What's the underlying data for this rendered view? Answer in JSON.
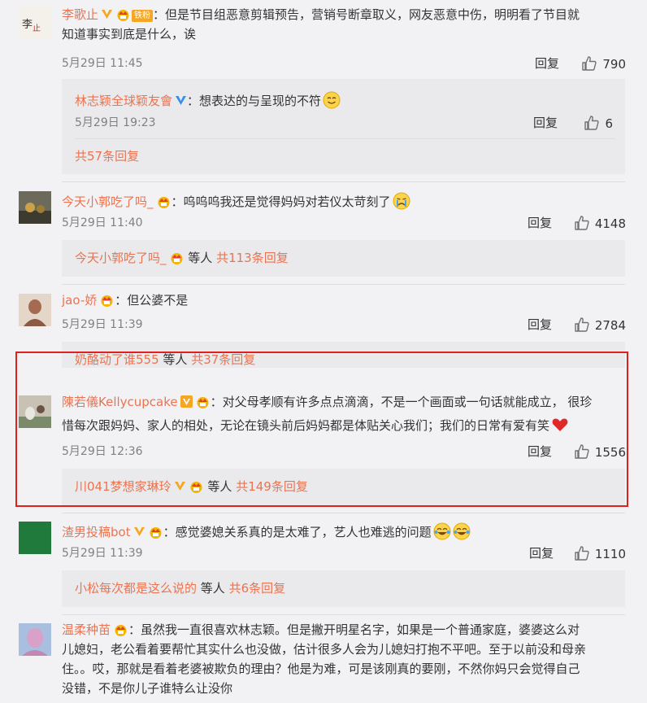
{
  "comments": [
    {
      "user": "李歌止",
      "fan_badge": "铁粉",
      "text_line1": "：但是节目组恶意剪辑预告，营销号断章取义，网友恶意中伤，明明看了节目就",
      "text_line2": "知道事实到底是什么，诶",
      "time": "5月29日 11:45",
      "reply_label": "回复",
      "likes": "790",
      "sub_reply": {
        "user": "林志颖全球颖友會",
        "text": "：想表达的与呈现的不符",
        "time": "5月29日 19:23",
        "reply_label": "回复",
        "likes": "6"
      },
      "more_replies": "共57条回复"
    },
    {
      "user": "今天小郭吃了吗_",
      "text": "：呜呜呜我还是觉得妈妈对若仪太苛刻了",
      "time": "5月29日 11:40",
      "reply_label": "回复",
      "likes": "4148",
      "replies_summary": {
        "user": "今天小郭吃了吗_",
        "middle": "等人",
        "count": "共113条回复"
      }
    },
    {
      "user": "jao-娇",
      "text": "：但公婆不是",
      "time": "5月29日 11:39",
      "reply_label": "回复",
      "likes": "2784",
      "replies_summary": {
        "user": "奶酪动了谁555",
        "middle": "等人",
        "count": "共37条回复"
      }
    },
    {
      "user": "陳若儀Kellycupcake",
      "text_line1": "：对父母孝顺有许多点点滴滴，不是一个画面或一句话就能成立， 很珍",
      "text_line2": "惜每次跟妈妈、家人的相处，无论在镜头前后妈妈都是体贴关心我们；我们的日常有爱有笑",
      "time": "5月29日 12:36",
      "reply_label": "回复",
      "likes": "1556",
      "replies_summary": {
        "user": "川041梦想家琳玲",
        "middle": "等人",
        "count": "共149条回复"
      }
    },
    {
      "user": "渣男投稿bot",
      "text": "：感觉婆媳关系真的是太难了，艺人也难逃的问题",
      "time": "5月29日 11:39",
      "reply_label": "回复",
      "likes": "1110",
      "replies_summary": {
        "user": "小松每次都是这么说的",
        "middle": "等人",
        "count": "共6条回复"
      }
    },
    {
      "user": "温柔种苗",
      "text_line1": "：虽然我一直很喜欢林志颖。但是撇开明星名字，如果是一个普通家庭，婆婆这么对",
      "text_line2": "儿媳妇，老公看着要帮忙其实什么也没做，估计很多人会为儿媳妇打抱不平吧。至于以前没和母亲",
      "text_line3": "住。。哎，那就是看着老婆被欺负的理由？他是为难，可是该刚真的要刚，不然你妈只会觉得自己",
      "text_line4": "没错，不是你儿子谁特么让没你"
    }
  ],
  "colors": {
    "name": "#eb7350",
    "highlight_border": "#e02020",
    "vip": "#f5a623"
  },
  "icons": [
    "verified-v-icon",
    "member-crown-icon",
    "thumbs-up-icon",
    "smile-emoji",
    "cry-emoji",
    "heart-emoji",
    "laugh-cry-emoji"
  ]
}
